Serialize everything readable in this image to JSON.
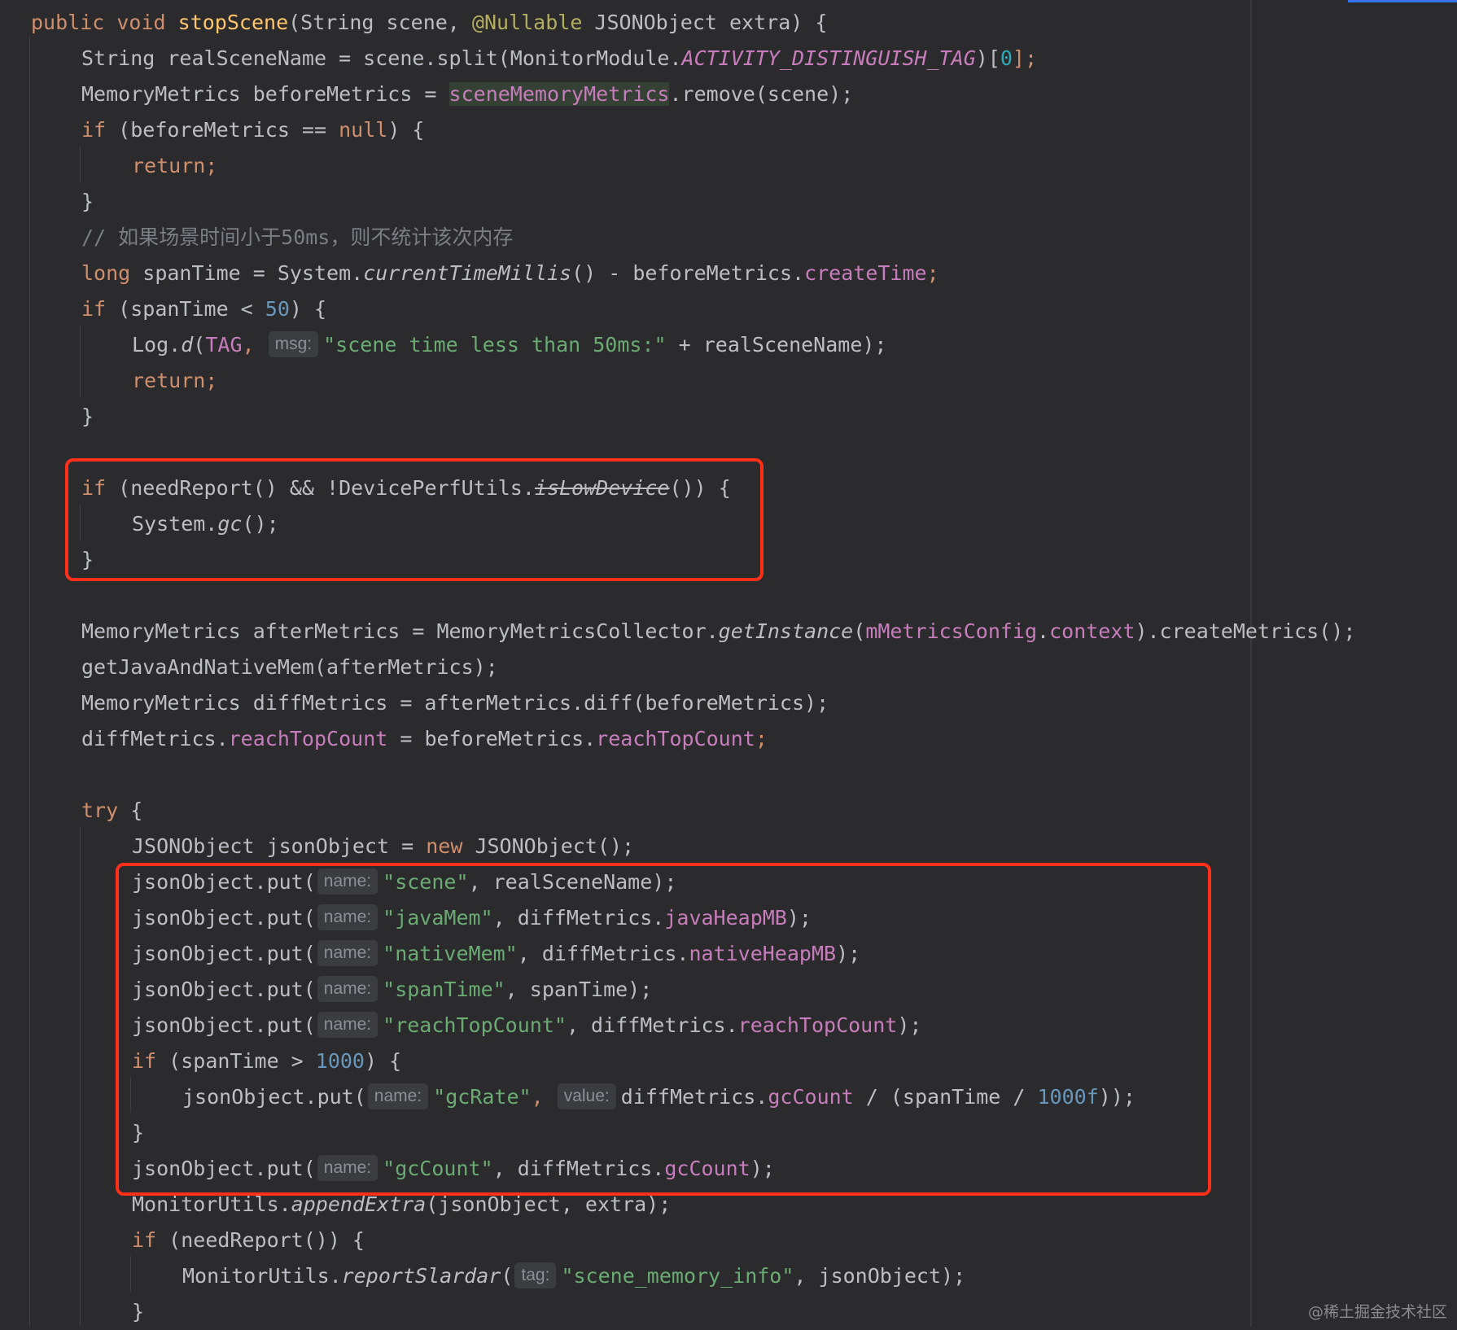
{
  "code": {
    "line_01": {
      "kw1": "public",
      "kw2": "void",
      "method": "stopScene",
      "p1": "(String scene, ",
      "annotation": "@Nullable",
      "p2": " JSONObject extra) {"
    },
    "line_02": {
      "a": "String realSceneName = scene.split(MonitorModule.",
      "const": "ACTIVITY_DISTINGUISH_TAG",
      "b": ")[",
      "num": "0",
      "c": "];"
    },
    "line_03": {
      "a": "MemoryMetrics beforeMetrics = ",
      "field": "sceneMemoryMetrics",
      "b": ".remove(scene);"
    },
    "line_04": {
      "kw": "if",
      "a": " (beforeMetrics == ",
      "kw2": "null",
      "b": ") {"
    },
    "line_05": {
      "kw": "return;"
    },
    "line_06": {
      "a": "}"
    },
    "line_07": {
      "comment": "// 如果场景时间小于50ms，则不统计该次内存"
    },
    "line_08": {
      "kw": "long",
      "a": " spanTime = System.",
      "static": "currentTimeMillis",
      "b": "() - beforeMetrics.",
      "field": "createTime",
      "c": ";"
    },
    "line_09": {
      "kw": "if",
      "a": " (spanTime < ",
      "num": "50",
      "b": ") {"
    },
    "line_10": {
      "a": "Log.",
      "static": "d",
      "b": "(",
      "field": "TAG",
      "c": ", ",
      "hint": "msg:",
      "str": "\"scene time less than 50ms:\"",
      "d": " + realSceneName);"
    },
    "line_11": {
      "kw": "return;"
    },
    "line_12": {
      "a": "}"
    },
    "line_13": {
      "kw": "if",
      "a": " (needReport() && !DevicePerfUtils.",
      "strike": "isLowDevice",
      "b": "()) {"
    },
    "line_14": {
      "a": "System.",
      "static": "gc",
      "b": "();"
    },
    "line_15": {
      "a": "}"
    },
    "line_16": {
      "a": "MemoryMetrics afterMetrics = MemoryMetricsCollector.",
      "static": "getInstance",
      "b": "(",
      "field1": "mMetricsConfig",
      "c": ".",
      "field2": "context",
      "d": ").createMetrics();"
    },
    "line_17": {
      "a": "getJavaAndNativeMem(afterMetrics);"
    },
    "line_18": {
      "a": "MemoryMetrics diffMetrics = afterMetrics.diff(beforeMetrics);"
    },
    "line_19": {
      "a": "diffMetrics.",
      "field1": "reachTopCount",
      "b": " = beforeMetrics.",
      "field2": "reachTopCount",
      "c": ";"
    },
    "line_20": {
      "kw": "try",
      "a": " {"
    },
    "line_21": {
      "a": "JSONObject jsonObject = ",
      "kw": "new",
      "b": " JSONObject();"
    },
    "line_22": {
      "a": "jsonObject.put(",
      "hint": "name:",
      "str": "\"scene\"",
      "b": ", realSceneName);"
    },
    "line_23": {
      "a": "jsonObject.put(",
      "hint": "name:",
      "str": "\"javaMem\"",
      "b": ", diffMetrics.",
      "field": "javaHeapMB",
      "c": ");"
    },
    "line_24": {
      "a": "jsonObject.put(",
      "hint": "name:",
      "str": "\"nativeMem\"",
      "b": ", diffMetrics.",
      "field": "nativeHeapMB",
      "c": ");"
    },
    "line_25": {
      "a": "jsonObject.put(",
      "hint": "name:",
      "str": "\"spanTime\"",
      "b": ", spanTime);"
    },
    "line_26": {
      "a": "jsonObject.put(",
      "hint": "name:",
      "str": "\"reachTopCount\"",
      "b": ", diffMetrics.",
      "field": "reachTopCount",
      "c": ");"
    },
    "line_27": {
      "kw": "if",
      "a": " (spanTime > ",
      "num": "1000",
      "b": ") {"
    },
    "line_28": {
      "a": "jsonObject.put(",
      "hint1": "name:",
      "str": "\"gcRate\"",
      "b": ", ",
      "hint2": "value:",
      "c": "diffMetrics.",
      "field": "gcCount",
      "d": " / (spanTime / ",
      "num": "1000f",
      "e": "));"
    },
    "line_29": {
      "a": "}"
    },
    "line_30": {
      "a": "jsonObject.put(",
      "hint": "name:",
      "str": "\"gcCount\"",
      "b": ", diffMetrics.",
      "field": "gcCount",
      "c": ");"
    },
    "line_31": {
      "a": "MonitorUtils.",
      "static": "appendExtra",
      "b": "(jsonObject, extra);"
    },
    "line_32": {
      "kw": "if",
      "a": " (needReport()) {"
    },
    "line_33": {
      "a": "MonitorUtils.",
      "static": "reportSlardar",
      "b": "(",
      "hint": "tag:",
      "str": "\"scene_memory_info\"",
      "c": ", jsonObject);"
    },
    "line_34": {
      "a": "}"
    }
  },
  "watermark": "@稀土掘金技术社区",
  "colors": {
    "background": "#2b2b2d",
    "keyword": "#cf8e6d",
    "string": "#6aab73",
    "field": "#c77dbb",
    "highlight_box": "#ff2f19"
  }
}
